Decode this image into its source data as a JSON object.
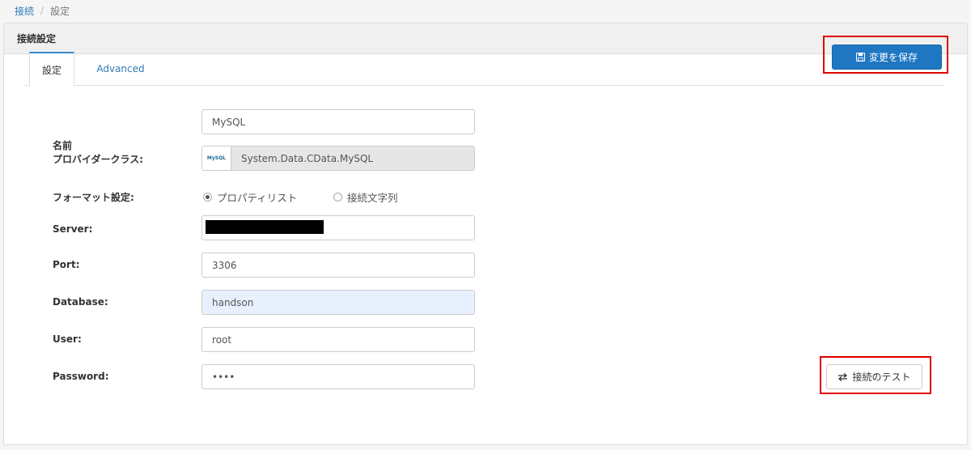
{
  "breadcrumb": {
    "items": [
      "接続",
      "設定"
    ],
    "separator": "/"
  },
  "panel": {
    "title": "接続設定"
  },
  "tabs": [
    {
      "label": "設定",
      "active": true
    },
    {
      "label": "Advanced",
      "active": false
    }
  ],
  "actions": {
    "save_label": "変更を保存",
    "save_icon": "floppy-disk-icon",
    "test_label": "接続のテスト",
    "test_icon": "exchange-arrows-icon"
  },
  "form": {
    "name": {
      "label": "名前",
      "value": "MySQL"
    },
    "provider": {
      "label": "プロバイダークラス:",
      "value": "System.Data.CData.MySQL",
      "logo_text": "MySQL"
    },
    "format": {
      "label": "フォーマット設定:",
      "options": [
        {
          "label": "プロパティリスト",
          "selected": true
        },
        {
          "label": "接続文字列",
          "selected": false
        }
      ]
    },
    "server": {
      "label": "Server:",
      "value": ""
    },
    "port": {
      "label": "Port:",
      "value": "3306"
    },
    "database": {
      "label": "Database:",
      "value": "handson"
    },
    "user": {
      "label": "User:",
      "value": "root"
    },
    "password": {
      "label": "Password:",
      "value": "••••"
    }
  },
  "colors": {
    "primary": "#1f76c2",
    "highlight_box": "#e00000",
    "link": "#337ab7"
  }
}
